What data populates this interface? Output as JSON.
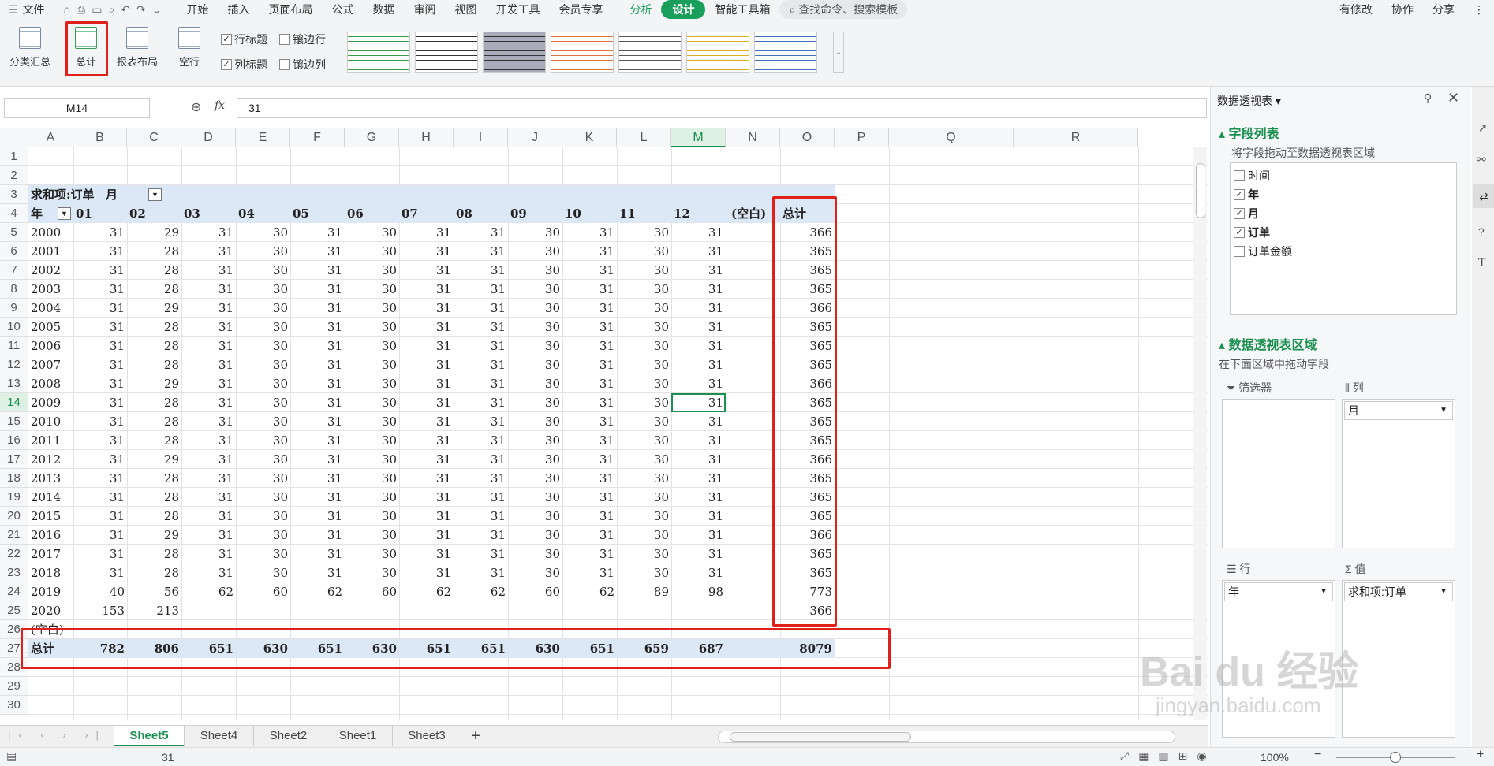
{
  "menu": {
    "items": [
      "文件",
      "开始",
      "插入",
      "页面布局",
      "公式",
      "数据",
      "审阅",
      "视图",
      "开发工具",
      "会员专享",
      "分析",
      "设计",
      "智能工具箱"
    ],
    "search": "查找命令、搜索模板",
    "right": [
      "有修改",
      "协作",
      "分享"
    ]
  },
  "ribbon": {
    "buttons": [
      "分类汇总",
      "总计",
      "报表布局",
      "空行"
    ],
    "checks": [
      {
        "label": "行标题",
        "checked": true
      },
      {
        "label": "镶边行",
        "checked": false
      },
      {
        "label": "列标题",
        "checked": true
      },
      {
        "label": "镶边列",
        "checked": false
      }
    ]
  },
  "formula": {
    "namebox": "M14",
    "fx": "fx",
    "value": "31"
  },
  "columns": [
    "A",
    "B",
    "C",
    "D",
    "E",
    "F",
    "G",
    "H",
    "I",
    "J",
    "K",
    "L",
    "M",
    "N",
    "O",
    "P",
    "Q",
    "R"
  ],
  "rows": [
    "1",
    "2",
    "3",
    "4",
    "5",
    "6",
    "7",
    "8",
    "9",
    "10",
    "11",
    "12",
    "13",
    "14",
    "15",
    "16",
    "17",
    "18",
    "19",
    "20",
    "21",
    "22",
    "23",
    "24",
    "25",
    "26",
    "27",
    "28",
    "29",
    "30"
  ],
  "pivot": {
    "header_sum": "求和项:订单",
    "header_month": "月",
    "row_label": "年",
    "months": [
      "01",
      "02",
      "03",
      "04",
      "05",
      "06",
      "07",
      "08",
      "09",
      "10",
      "11",
      "12",
      "(空白)",
      "总计"
    ],
    "data": [
      [
        "2000",
        "31",
        "29",
        "31",
        "30",
        "31",
        "30",
        "31",
        "31",
        "30",
        "31",
        "30",
        "31",
        "",
        "366"
      ],
      [
        "2001",
        "31",
        "28",
        "31",
        "30",
        "31",
        "30",
        "31",
        "31",
        "30",
        "31",
        "30",
        "31",
        "",
        "365"
      ],
      [
        "2002",
        "31",
        "28",
        "31",
        "30",
        "31",
        "30",
        "31",
        "31",
        "30",
        "31",
        "30",
        "31",
        "",
        "365"
      ],
      [
        "2003",
        "31",
        "28",
        "31",
        "30",
        "31",
        "30",
        "31",
        "31",
        "30",
        "31",
        "30",
        "31",
        "",
        "365"
      ],
      [
        "2004",
        "31",
        "29",
        "31",
        "30",
        "31",
        "30",
        "31",
        "31",
        "30",
        "31",
        "30",
        "31",
        "",
        "366"
      ],
      [
        "2005",
        "31",
        "28",
        "31",
        "30",
        "31",
        "30",
        "31",
        "31",
        "30",
        "31",
        "30",
        "31",
        "",
        "365"
      ],
      [
        "2006",
        "31",
        "28",
        "31",
        "30",
        "31",
        "30",
        "31",
        "31",
        "30",
        "31",
        "30",
        "31",
        "",
        "365"
      ],
      [
        "2007",
        "31",
        "28",
        "31",
        "30",
        "31",
        "30",
        "31",
        "31",
        "30",
        "31",
        "30",
        "31",
        "",
        "365"
      ],
      [
        "2008",
        "31",
        "29",
        "31",
        "30",
        "31",
        "30",
        "31",
        "31",
        "30",
        "31",
        "30",
        "31",
        "",
        "366"
      ],
      [
        "2009",
        "31",
        "28",
        "31",
        "30",
        "31",
        "30",
        "31",
        "31",
        "30",
        "31",
        "30",
        "31",
        "",
        "365"
      ],
      [
        "2010",
        "31",
        "28",
        "31",
        "30",
        "31",
        "30",
        "31",
        "31",
        "30",
        "31",
        "30",
        "31",
        "",
        "365"
      ],
      [
        "2011",
        "31",
        "28",
        "31",
        "30",
        "31",
        "30",
        "31",
        "31",
        "30",
        "31",
        "30",
        "31",
        "",
        "365"
      ],
      [
        "2012",
        "31",
        "29",
        "31",
        "30",
        "31",
        "30",
        "31",
        "31",
        "30",
        "31",
        "30",
        "31",
        "",
        "366"
      ],
      [
        "2013",
        "31",
        "28",
        "31",
        "30",
        "31",
        "30",
        "31",
        "31",
        "30",
        "31",
        "30",
        "31",
        "",
        "365"
      ],
      [
        "2014",
        "31",
        "28",
        "31",
        "30",
        "31",
        "30",
        "31",
        "31",
        "30",
        "31",
        "30",
        "31",
        "",
        "365"
      ],
      [
        "2015",
        "31",
        "28",
        "31",
        "30",
        "31",
        "30",
        "31",
        "31",
        "30",
        "31",
        "30",
        "31",
        "",
        "365"
      ],
      [
        "2016",
        "31",
        "29",
        "31",
        "30",
        "31",
        "30",
        "31",
        "31",
        "30",
        "31",
        "30",
        "31",
        "",
        "366"
      ],
      [
        "2017",
        "31",
        "28",
        "31",
        "30",
        "31",
        "30",
        "31",
        "31",
        "30",
        "31",
        "30",
        "31",
        "",
        "365"
      ],
      [
        "2018",
        "31",
        "28",
        "31",
        "30",
        "31",
        "30",
        "31",
        "31",
        "30",
        "31",
        "30",
        "31",
        "",
        "365"
      ],
      [
        "2019",
        "40",
        "56",
        "62",
        "60",
        "62",
        "60",
        "62",
        "62",
        "60",
        "62",
        "89",
        "98",
        "",
        "773"
      ],
      [
        "2020",
        "153",
        "213",
        "",
        "",
        "",
        "",
        "",
        "",
        "",
        "",
        "",
        "",
        "",
        "366"
      ],
      [
        "(空白)",
        "",
        "",
        "",
        "",
        "",
        "",
        "",
        "",
        "",
        "",
        "",
        "",
        "",
        ""
      ]
    ],
    "total": [
      "总计",
      "782",
      "806",
      "651",
      "630",
      "651",
      "630",
      "651",
      "651",
      "630",
      "651",
      "659",
      "687",
      "",
      "8079"
    ]
  },
  "sheets": [
    "Sheet5",
    "Sheet4",
    "Sheet2",
    "Sheet1",
    "Sheet3"
  ],
  "status": {
    "value": "31",
    "zoom": "100%"
  },
  "panel": {
    "title": "数据透视表",
    "fields_title": "字段列表",
    "fields_hint": "将字段拖动至数据透视表区域",
    "fields": [
      {
        "label": "时间",
        "checked": false
      },
      {
        "label": "年",
        "checked": true
      },
      {
        "label": "月",
        "checked": true
      },
      {
        "label": "订单",
        "checked": true
      },
      {
        "label": "订单金额",
        "checked": false
      }
    ],
    "area_title": "数据透视表区域",
    "area_hint": "在下面区域中拖动字段",
    "filter_label": "筛选器",
    "col_label": "列",
    "row_label": "行",
    "val_label": "值",
    "col_value": "月",
    "row_value": "年",
    "val_value": "求和项:订单"
  },
  "watermark": {
    "brand": "Bai du 经验",
    "url": "jingyan.baidu.com"
  }
}
